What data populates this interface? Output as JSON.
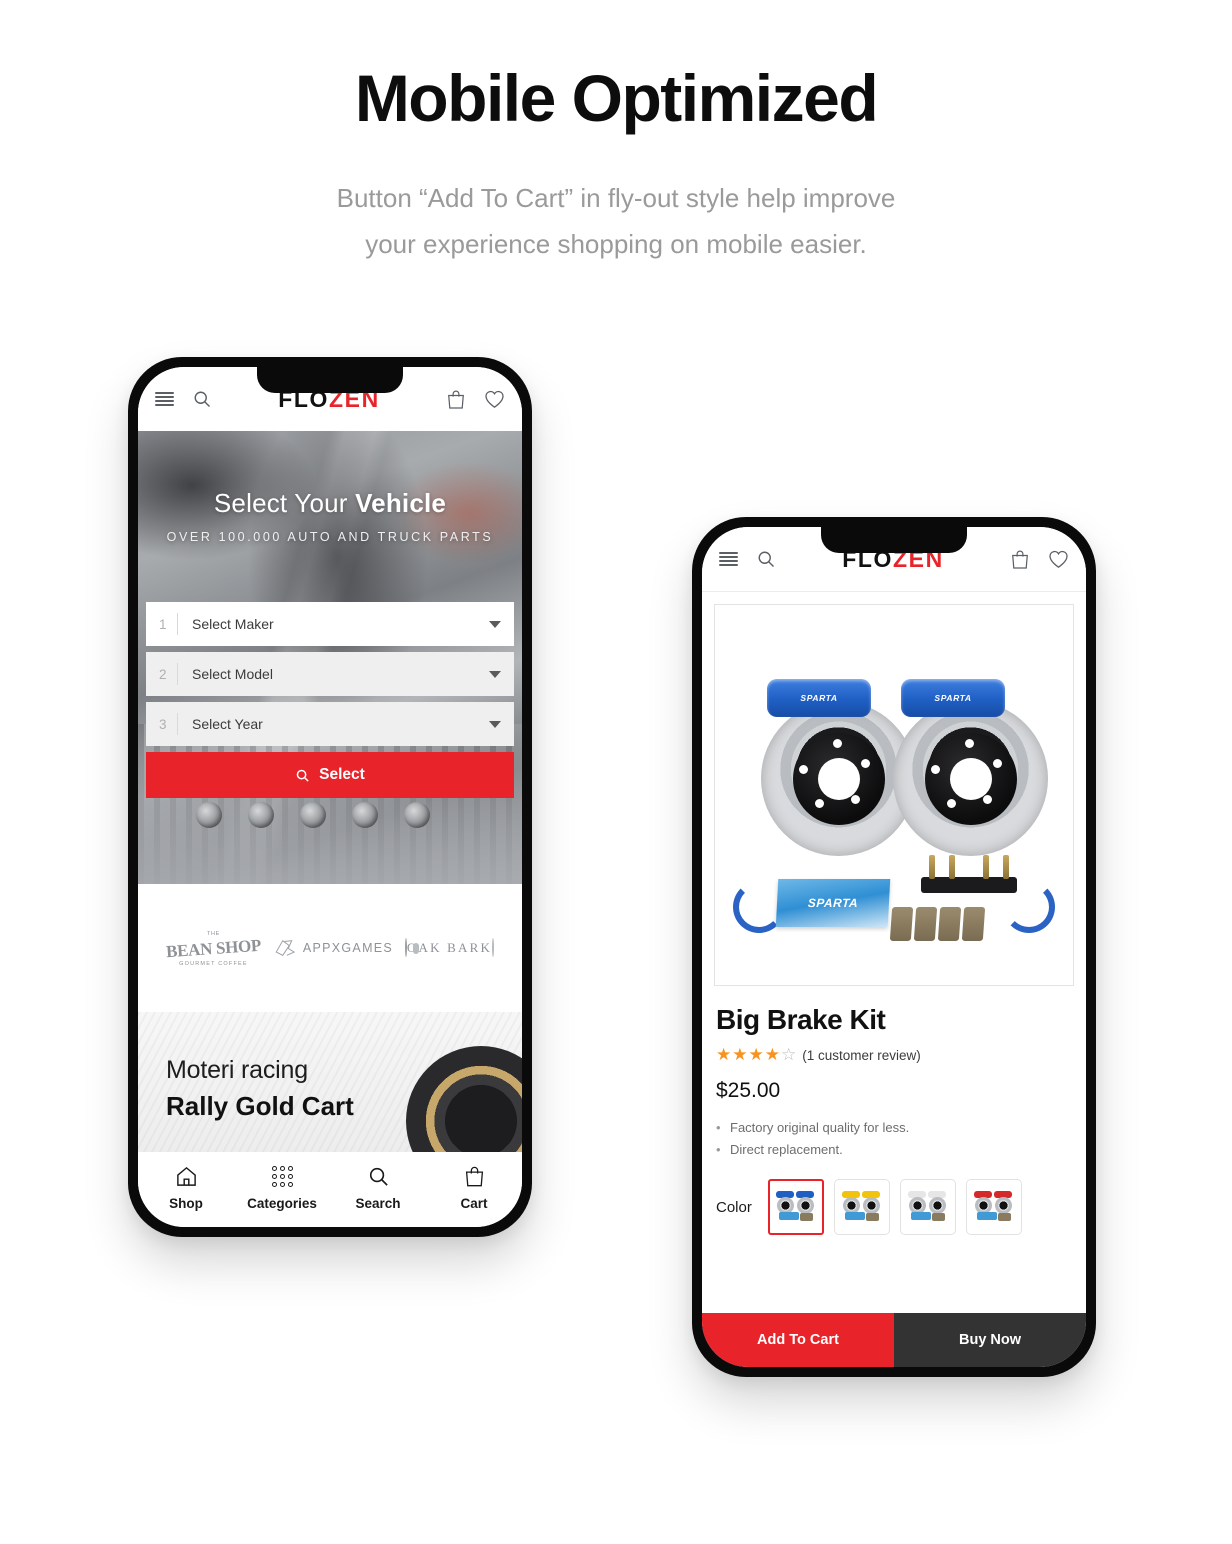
{
  "hero_section": {
    "headline": "Mobile Optimized",
    "subhead_line1": "Button “Add To Cart” in fly-out style help improve",
    "subhead_line2": "your experience shopping on mobile easier."
  },
  "colors": {
    "brand_red": "#e8232a",
    "dark": "#0a0a0a",
    "buy_now_grey": "#333333",
    "star_orange": "#f7931e"
  },
  "phone1": {
    "appbar": {
      "menu_icon": "hamburger-icon",
      "search_icon": "search-icon",
      "logo_part1": "FLO",
      "logo_part2": "ZEN",
      "cart_icon": "shopping-bag-icon",
      "wishlist_icon": "heart-icon"
    },
    "hero": {
      "title_light": "Select Your ",
      "title_bold": "Vehicle",
      "subtitle": "OVER 100.000 AUTO AND TRUCK PARTS"
    },
    "vehicle_selector": {
      "rows": [
        {
          "num": "1",
          "label": "Select Maker"
        },
        {
          "num": "2",
          "label": "Select Model"
        },
        {
          "num": "3",
          "label": "Select Year"
        }
      ],
      "button_label": "Select",
      "button_icon": "search-icon"
    },
    "brands": [
      {
        "name": "the-bean-shop",
        "top": "THE",
        "mid": "BEAN SHOP",
        "bottom": "GOURMET COFFEE"
      },
      {
        "name": "appxgames",
        "text": "APPXGAMES"
      },
      {
        "name": "oak-bark",
        "text": "OAK BARK"
      }
    ],
    "promo": {
      "line1": "Moteri racing",
      "line2": "Rally Gold Cart"
    },
    "tabbar": [
      {
        "icon": "home-icon",
        "label": "Shop"
      },
      {
        "icon": "grid-dots-icon",
        "label": "Categories"
      },
      {
        "icon": "search-icon",
        "label": "Search"
      },
      {
        "icon": "shopping-bag-icon",
        "label": "Cart"
      }
    ]
  },
  "phone2": {
    "appbar": {
      "menu_icon": "hamburger-icon",
      "search_icon": "search-icon",
      "logo_part1": "FLO",
      "logo_part2": "ZEN",
      "cart_icon": "shopping-bag-icon",
      "wishlist_icon": "heart-icon"
    },
    "product": {
      "image_alt": "SPARTA big brake kit with blue calipers, slotted rotors and brake pads",
      "image_brand": "SPARTA",
      "title": "Big Brake Kit",
      "rating_filled": "★★★★",
      "rating_empty": "☆",
      "review_count": "(1 customer review)",
      "price": "$25.00",
      "features": [
        "Factory original quality for less.",
        "Direct replacement."
      ],
      "color_label": "Color",
      "color_options": [
        {
          "name": "blue",
          "hex": "#1f5fc4",
          "selected": true
        },
        {
          "name": "yellow",
          "hex": "#f2c30d",
          "selected": false
        },
        {
          "name": "silver",
          "hex": "#e6e6e6",
          "selected": false
        },
        {
          "name": "red",
          "hex": "#d62828",
          "selected": false
        }
      ]
    },
    "cta": {
      "add_to_cart": "Add To Cart",
      "buy_now": "Buy Now"
    }
  }
}
